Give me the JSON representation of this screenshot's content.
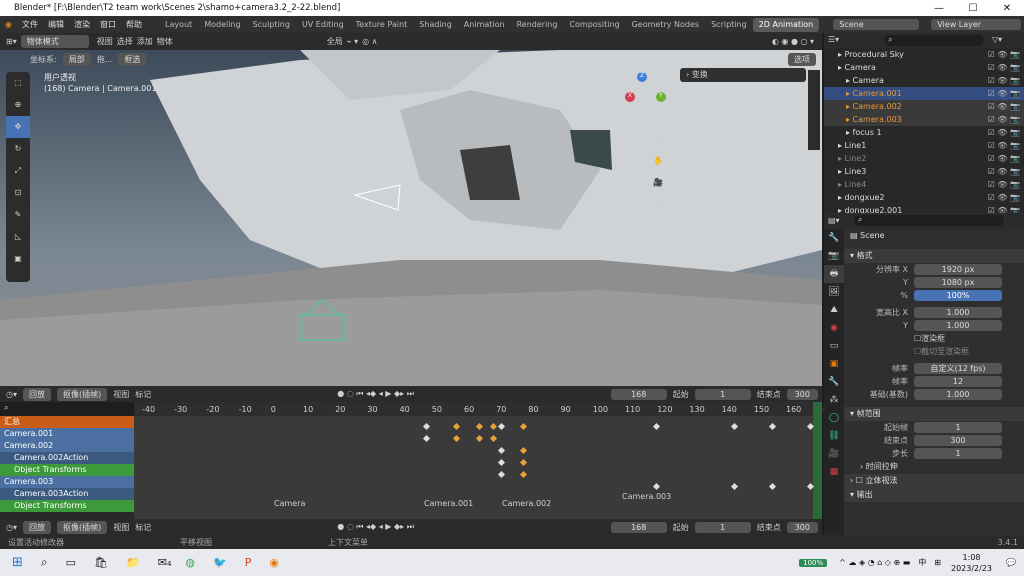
{
  "title": "Blender* [F:\\Blender\\T2 team work\\Scenes 2\\shamo+camera3.2_2-22.blend]",
  "menus": [
    "文件",
    "编辑",
    "渲染",
    "窗口",
    "帮助"
  ],
  "workspaces": [
    "Layout",
    "Modeling",
    "Sculpting",
    "UV Editing",
    "Texture Paint",
    "Shading",
    "Animation",
    "Rendering",
    "Compositing",
    "Geometry Nodes",
    "Scripting",
    "2D Animation"
  ],
  "scene": "Scene",
  "view_layer": "View Layer",
  "viewport": {
    "mode": "物体模式",
    "menu": [
      "视图",
      "选择",
      "添加",
      "物体"
    ],
    "global": "全局",
    "coord_label": "坐标系:",
    "coord": "局部",
    "drag": "拖...",
    "select": "框选",
    "options": "选项",
    "persp": "用户透视",
    "info": "(168) Camera | Camera.001",
    "transform": "变换"
  },
  "timeline": {
    "playback": "回放",
    "keying": "抠像(插帧)",
    "view": "视图",
    "markers": "标记",
    "frame": "168",
    "start_label": "起始",
    "start": "1",
    "end_label": "结束点",
    "end": "300"
  },
  "dopesheet": {
    "ticks": [
      "-40",
      "-30",
      "-20",
      "-10",
      "0",
      "10",
      "20",
      "30",
      "40",
      "50",
      "60",
      "70",
      "80",
      "90",
      "100",
      "110",
      "120",
      "130",
      "140",
      "150",
      "160",
      "16"
    ],
    "rows": [
      "汇总",
      "Camera.001",
      "Camera.002",
      "Camera.002Action",
      "Object Transforms",
      "Camera.003",
      "Camera.003Action",
      "Object Transforms"
    ],
    "markers": [
      "Camera",
      "Camera.001",
      "Camera.002",
      "Camera.003"
    ]
  },
  "status": {
    "a": "设置活动修改器",
    "b": "平移视图",
    "c": "上下文菜单",
    "version": "3.4.1"
  },
  "outliner": [
    "Procedural Sky",
    "Camera",
    "Camera",
    "Camera.001",
    "Camera.002",
    "Camera.003",
    "focus 1",
    "Line1",
    "Line2",
    "Line3",
    "Line4",
    "dongxue2",
    "dongxue2.001"
  ],
  "props": {
    "scene": "Scene",
    "format": "格式",
    "resx_label": "分辨率 X",
    "resx": "1920 px",
    "resy_label": "Y",
    "resy": "1080 px",
    "pct_label": "%",
    "pct": "100%",
    "aspx_label": "宽高比 X",
    "aspx": "1.000",
    "aspy_label": "Y",
    "aspy": "1.000",
    "border": "渲染框",
    "crop": "截切至渲染框",
    "fps_label": "帧率",
    "fps": "自定义(12 fps)",
    "fpsn_label": "帧率",
    "fpsn": "12",
    "base_label": "基础(基数)",
    "base": "1.000",
    "range": "帧范围",
    "fstart_label": "起始帧",
    "fstart": "1",
    "fend_label": "结束点",
    "fend": "300",
    "step_label": "步长",
    "step": "1",
    "stretch": "时间拉伸",
    "stereo": "立体视法",
    "output": "输出"
  },
  "taskbar": {
    "battery": "100%",
    "lang": "中",
    "time": "1:08",
    "date": "2023/2/23",
    "notif": "4"
  }
}
